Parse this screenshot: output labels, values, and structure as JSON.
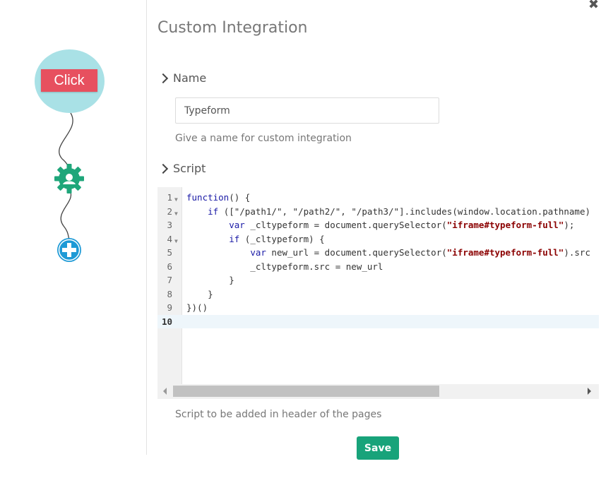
{
  "flow": {
    "click_label": "Click",
    "accent_click": "#e7505f",
    "node_color": "#a9e1e6",
    "gear_color": "#1fa67a",
    "plus_color": "#1e9ad6"
  },
  "panel": {
    "title": "Custom Integration",
    "name_section": "Name",
    "name_value": "Typeform",
    "name_help": "Give a name for custom integration",
    "script_section": "Script",
    "script_help": "Script to be added in header of the pages",
    "save_label": "Save"
  },
  "editor": {
    "lines": [
      {
        "n": "1",
        "fold": true,
        "code": "function() {"
      },
      {
        "n": "2",
        "fold": true,
        "code": "    if ([\"/path1/\", \"/path2/\", \"/path3/\"].includes(window.location.pathname)"
      },
      {
        "n": "3",
        "fold": false,
        "code": "        var _cltypeform = document.querySelector(\"iframe#typeform-full\");"
      },
      {
        "n": "4",
        "fold": true,
        "code": "        if (_cltypeform) {"
      },
      {
        "n": "5",
        "fold": false,
        "code": "            var new_url = document.querySelector(\"iframe#typeform-full\").src"
      },
      {
        "n": "6",
        "fold": false,
        "code": "            _cltypeform.src = new_url"
      },
      {
        "n": "7",
        "fold": false,
        "code": "        }"
      },
      {
        "n": "8",
        "fold": false,
        "code": "    }"
      },
      {
        "n": "9",
        "fold": false,
        "code": "})()"
      },
      {
        "n": "10",
        "fold": false,
        "code": ""
      }
    ]
  }
}
